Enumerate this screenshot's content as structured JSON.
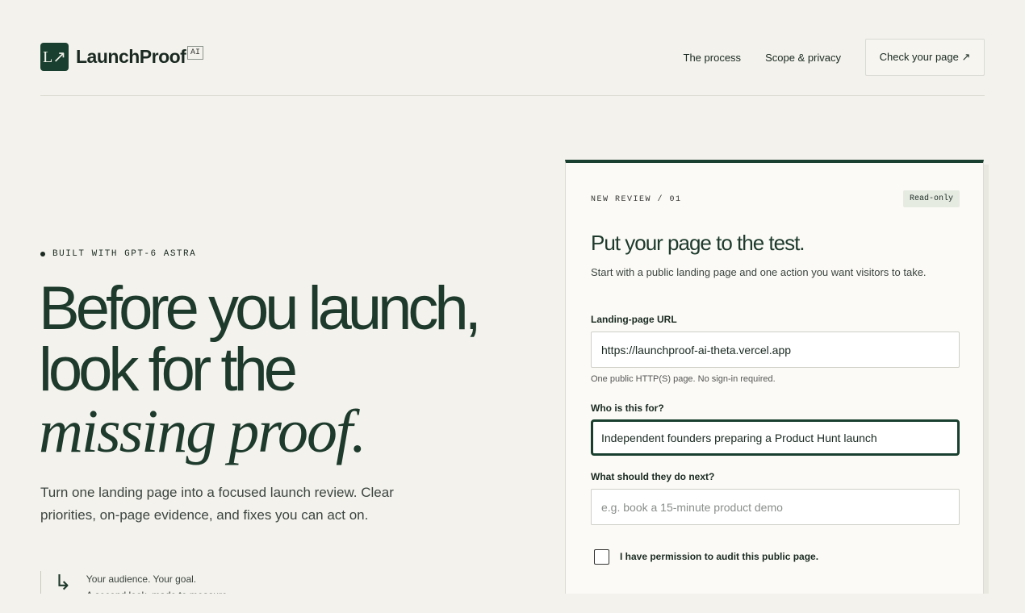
{
  "brand": {
    "logo_glyph": "L↗",
    "name": "LaunchProof",
    "badge": "AI"
  },
  "nav": {
    "links": [
      "The process",
      "Scope & privacy"
    ],
    "cta": "Check your page ↗"
  },
  "hero": {
    "eyebrow": "BUILT WITH GPT-6 ASTRA",
    "line1": "Before you launch,",
    "line2": "look for the",
    "line3": "missing proof.",
    "subtitle": "Turn one landing page into a focused launch review. Clear priorities, on-page evidence, and fixes you can act on.",
    "note_line1": "Your audience. Your goal.",
    "note_line2": "A second look, made to measure."
  },
  "card": {
    "tag": "NEW REVIEW / 01",
    "status": "Read-only",
    "title": "Put your page to the test.",
    "subtitle": "Start with a public landing page and one action you want visitors to take.",
    "url_label": "Landing-page URL",
    "url_value": "https://launchproof-ai-theta.vercel.app",
    "url_hint": "One public HTTP(S) page. No sign-in required.",
    "audience_label": "Who is this for?",
    "audience_value": "Independent founders preparing a Product Hunt launch",
    "goal_label": "What should they do next?",
    "goal_placeholder": "e.g. book a 15-minute product demo",
    "permission_label": "I have permission to audit this public page."
  },
  "colors": {
    "accent": "#183f2f",
    "background": "#f3f2ec",
    "card": "#fbfaf6"
  }
}
